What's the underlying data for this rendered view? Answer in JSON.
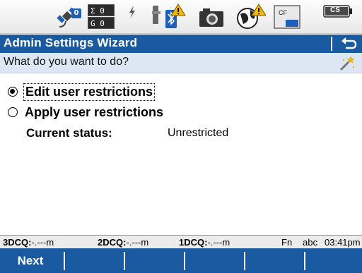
{
  "status_bar": {
    "satellite_count": "0",
    "count_top": "Σ 0",
    "count_bottom": "G 0",
    "cf_label": "CF",
    "battery_label": "CS",
    "icons": [
      "satellite-icon",
      "solution-count-icon",
      "lightning-icon",
      "bluetooth-link-warning-icon",
      "camera-icon",
      "globe-warning-icon",
      "cf-card-icon",
      "battery-icon"
    ]
  },
  "window": {
    "title": "Admin Settings Wizard",
    "back_icon": "return-arrow-icon"
  },
  "question": {
    "text": "What do you want to do?",
    "icon": "magic-wand-icon"
  },
  "options": [
    {
      "label": "Edit user restrictions",
      "selected": true
    },
    {
      "label": "Apply user restrictions",
      "selected": false
    }
  ],
  "status": {
    "label": "Current status:",
    "value": "Unrestricted"
  },
  "info_bar": {
    "dcq3_label": "3DCQ:",
    "dcq3_value": "-.---m",
    "dcq2_label": "2DCQ:",
    "dcq2_value": "-.---m",
    "dcq1_label": "1DCQ:",
    "dcq1_value": "-.---m",
    "fn": "Fn",
    "input_mode": "abc",
    "time": "03:41pm"
  },
  "softkeys": {
    "f1": "Next",
    "f2": "",
    "f3": "",
    "f4": "",
    "f5": "",
    "f6": ""
  },
  "colors": {
    "title_bar": "#1a5aa0",
    "question_bg": "#dde7f3",
    "softkey_bar": "#1a5aa0",
    "warning": "#f2b705"
  }
}
